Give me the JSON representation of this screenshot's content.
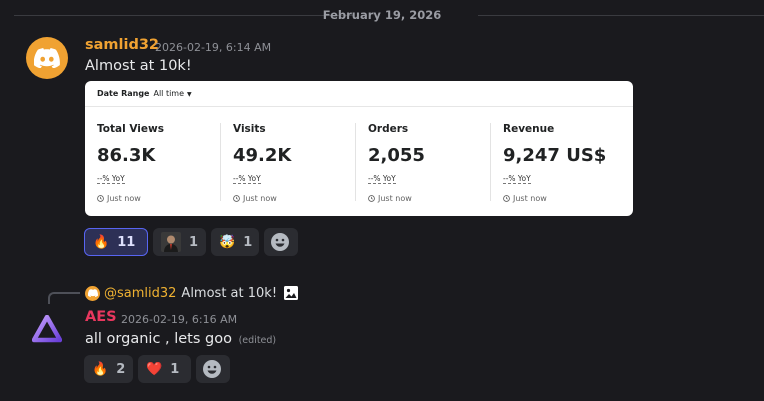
{
  "date_divider": "February 19, 2026",
  "messages": [
    {
      "username": "samlid32",
      "username_color": "#f0a232",
      "timestamp": "2026-02-19, 6:14 AM",
      "text": "Almost at 10k!",
      "avatar_icon": "discord-logo-icon",
      "embed": {
        "date_range_label": "Date Range",
        "date_range_value": "All time",
        "stats": [
          {
            "label": "Total Views",
            "value": "86.3K",
            "yoy": "--% YoY",
            "updated": "Just now"
          },
          {
            "label": "Visits",
            "value": "49.2K",
            "yoy": "--% YoY",
            "updated": "Just now"
          },
          {
            "label": "Orders",
            "value": "2,055",
            "yoy": "--% YoY",
            "updated": "Just now"
          },
          {
            "label": "Revenue",
            "value": "9,247 US$",
            "yoy": "--% YoY",
            "updated": "Just now"
          }
        ]
      },
      "reactions": [
        {
          "emoji": "🔥",
          "count": "11",
          "active": true
        },
        {
          "emoji": "portrait",
          "count": "1",
          "active": false
        },
        {
          "emoji": "🤯",
          "count": "1",
          "active": false
        }
      ]
    },
    {
      "username": "AES",
      "username_color": "#e8375e",
      "timestamp": "2026-02-19, 6:16 AM",
      "text": "all organic , lets goo",
      "edited": "(edited)",
      "avatar_icon": "triangle-logo-icon",
      "reply": {
        "mention": "@samlid32",
        "text": "Almost at 10k!",
        "attachment_icon": "image-icon"
      },
      "reactions": [
        {
          "emoji": "🔥",
          "count": "2",
          "active": false
        },
        {
          "emoji": "❤️",
          "count": "1",
          "active": false
        }
      ]
    }
  ],
  "colors": {
    "background": "#1a1a1e",
    "reaction_bg": "#2b2c31",
    "reaction_active_border": "#5865f2",
    "mention": "#f0b232"
  }
}
